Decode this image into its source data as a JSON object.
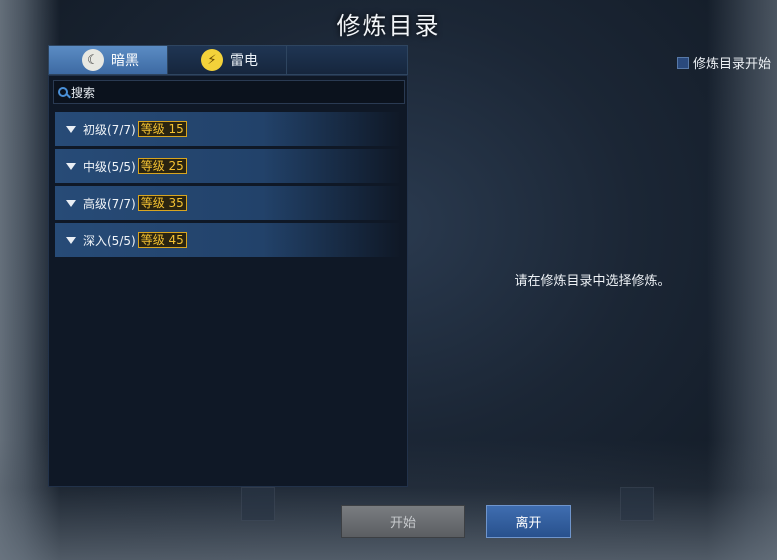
{
  "title": "修炼目录",
  "tabs": [
    {
      "label": "暗黑",
      "icon": "moon-icon",
      "active": true
    },
    {
      "label": "雷电",
      "icon": "lightning-icon",
      "active": false
    }
  ],
  "auto_start_label": "修炼目录开始",
  "search": {
    "placeholder": "搜索"
  },
  "categories": [
    {
      "name": "初级(7/7)",
      "level": "等级 15"
    },
    {
      "name": "中级(5/5)",
      "level": "等级 25"
    },
    {
      "name": "高级(7/7)",
      "level": "等级 35"
    },
    {
      "name": "深入(5/5)",
      "level": "等级 45"
    }
  ],
  "hint": "请在修炼目录中选择修炼。",
  "buttons": {
    "start": "开始",
    "leave": "离开"
  },
  "colors": {
    "accent": "#3d6aa3",
    "level_badge": "#f4c233"
  }
}
